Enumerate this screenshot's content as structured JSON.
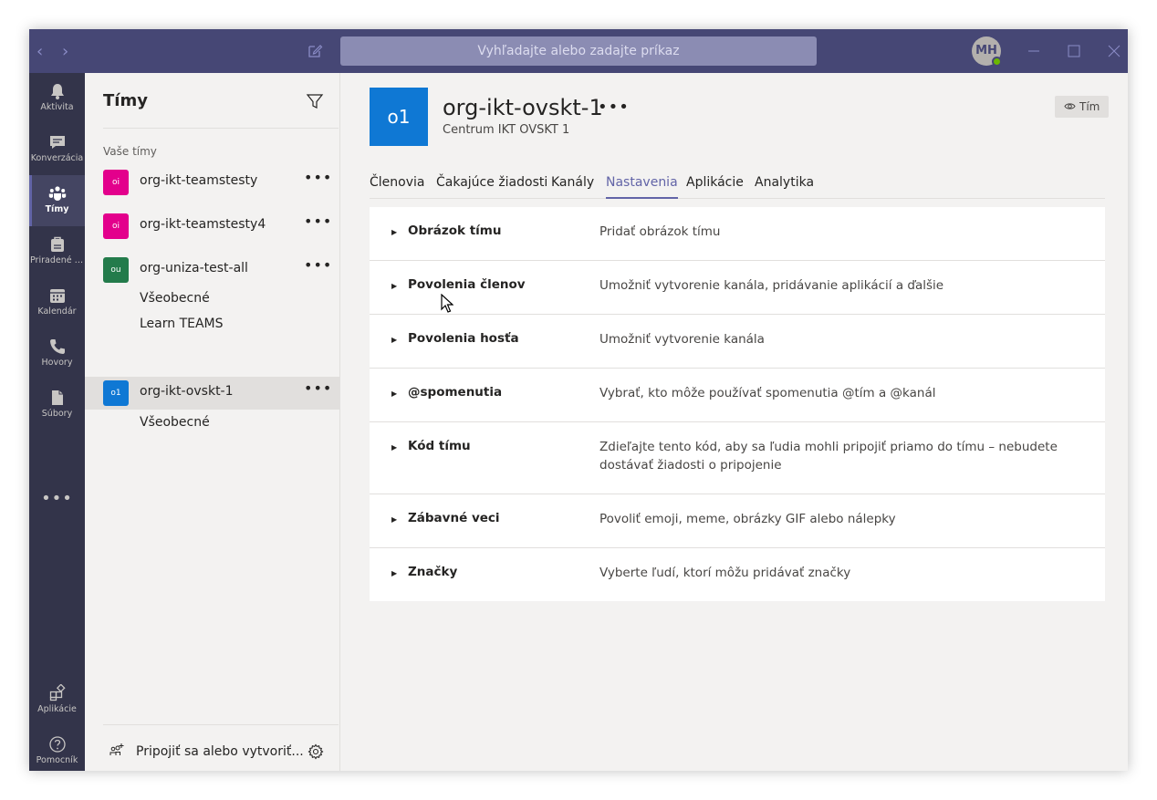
{
  "titlebar": {
    "search_placeholder": "Vyhľadajte alebo zadajte príkaz",
    "avatar_initials": "MH"
  },
  "appbar": {
    "items": [
      {
        "label": "Aktivita",
        "icon": "bell-icon"
      },
      {
        "label": "Konverzácia",
        "icon": "chat-icon"
      },
      {
        "label": "Tímy",
        "icon": "teams-icon",
        "active": true
      },
      {
        "label": "Priradené ú...",
        "icon": "assignments-icon"
      },
      {
        "label": "Kalendár",
        "icon": "calendar-icon"
      },
      {
        "label": "Hovory",
        "icon": "phone-icon"
      },
      {
        "label": "Súbory",
        "icon": "files-icon"
      }
    ],
    "bottom": [
      {
        "label": "Aplikácie",
        "icon": "apps-icon"
      },
      {
        "label": "Pomocník",
        "icon": "help-icon"
      }
    ]
  },
  "teams_panel": {
    "title": "Tímy",
    "section_label": "Vaše tímy",
    "teams": [
      {
        "initials": "oi",
        "name": "org-ikt-teamstesty",
        "color": "#e3008c",
        "channels": []
      },
      {
        "initials": "oi",
        "name": "org-ikt-teamstesty4",
        "color": "#e3008c",
        "channels": []
      },
      {
        "initials": "ou",
        "name": "org-uniza-test-all",
        "color": "#237b4b",
        "channels": [
          "Všeobecné",
          "Learn TEAMS"
        ]
      },
      {
        "initials": "o1",
        "name": "org-ikt-ovskt-1",
        "color": "#0f78d4",
        "channels": [
          "Všeobecné"
        ],
        "selected": true
      }
    ],
    "join_label": "Pripojiť sa alebo vytvoriť..."
  },
  "main": {
    "logo_initials": "o1",
    "team_name": "org-ikt-ovskt-1",
    "team_description": "Centrum IKT OVSKT 1",
    "badge_label": "Tím",
    "tabs": [
      {
        "label": "Členovia"
      },
      {
        "label": "Čakajúce žiadosti"
      },
      {
        "label": "Kanály"
      },
      {
        "label": "Nastavenia",
        "active": true
      },
      {
        "label": "Aplikácie"
      },
      {
        "label": "Analytika"
      }
    ],
    "settings": [
      {
        "name": "Obrázok tímu",
        "description": "Pridať obrázok tímu"
      },
      {
        "name": "Povolenia členov",
        "description": "Umožniť vytvorenie kanála, pridávanie aplikácií a ďalšie"
      },
      {
        "name": "Povolenia hosťa",
        "description": "Umožniť vytvorenie kanála"
      },
      {
        "name": "@spomenutia",
        "description": "Vybrať, kto môže používať spomenutia @tím a @kanál"
      },
      {
        "name": "Kód tímu",
        "description": "Zdieľajte tento kód, aby sa ľudia mohli pripojiť priamo do tímu – nebudete dostávať žiadosti o pripojenie"
      },
      {
        "name": "Zábavné veci",
        "description": "Povoliť emoji, meme, obrázky GIF alebo nálepky"
      },
      {
        "name": "Značky",
        "description": "Vyberte ľudí, ktorí môžu pridávať značky"
      }
    ]
  },
  "colors": {
    "accent": "#6264a7",
    "titlebar": "#464775",
    "appbar": "#33344a"
  }
}
